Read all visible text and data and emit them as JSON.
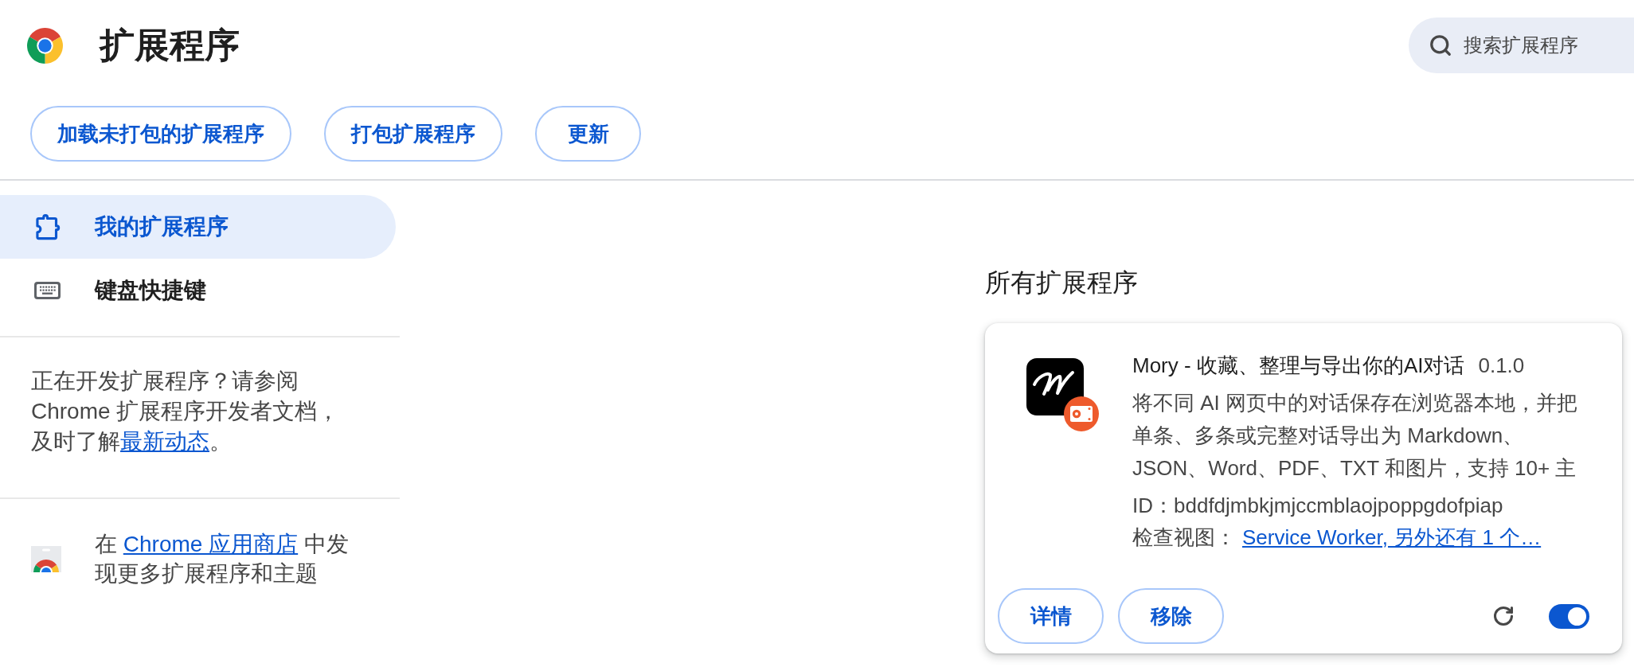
{
  "header": {
    "title": "扩展程序",
    "search": {
      "placeholder": "搜索扩展程序"
    }
  },
  "toolbar": {
    "buttons": [
      "加载未打包的扩展程序",
      "打包扩展程序",
      "更新"
    ]
  },
  "sidebar": {
    "items": [
      {
        "label": "我的扩展程序",
        "selected": true
      },
      {
        "label": "键盘快捷键",
        "selected": false
      }
    ],
    "developer_note": {
      "text": "正在开发扩展程序？请参阅 Chrome 扩展程序开发者文档，及时了解",
      "link": "最新动态",
      "text_after": "。"
    },
    "store_note": {
      "text": "在 ",
      "link": "Chrome 应用商店",
      "text_after": " 中发现更多扩展程序和主题"
    }
  },
  "main": {
    "title": "所有扩展程序",
    "extensions": [
      {
        "name": "Mory - 收藏、整理与导出你的AI对话",
        "version": "0.1.0",
        "description": "将不同 AI 网页中的对话保存在浏览器本地，并把单条、多条或完整对话导出为 Markdown、JSON、Word、PDF、TXT 和图片，支持 10+ 主",
        "id_line": "ID：bddfdjmbkjmjccmblaojpoppgdofpiap",
        "inspect_label": "检查视图：",
        "inspect_link": "Service Worker, 另外还有 1 个…",
        "buttons": [
          "详情",
          "移除"
        ],
        "enabled": true
      }
    ]
  }
}
